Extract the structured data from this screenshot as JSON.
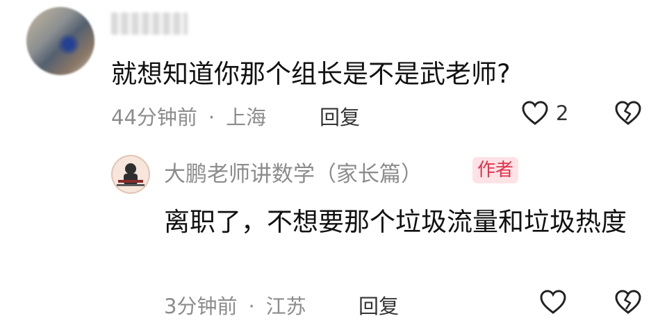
{
  "comment": {
    "text": "就想知道你那个组长是不是武老师?",
    "time": "44分钟前",
    "location": "上海",
    "reply_label": "回复",
    "like_count": "2"
  },
  "reply": {
    "author": "大鹏老师讲数学（家长篇）",
    "badge": "作者",
    "text": "离职了，不想要那个垃圾流量和垃圾热度",
    "time": "3分钟前",
    "location": "江苏",
    "reply_label": "回复"
  },
  "icons": {
    "like": "heart-outline-icon",
    "dislike": "broken-heart-icon"
  },
  "colors": {
    "badge_bg": "#fde3e5",
    "badge_text": "#e3314a",
    "meta_text": "#8c8c8c"
  }
}
